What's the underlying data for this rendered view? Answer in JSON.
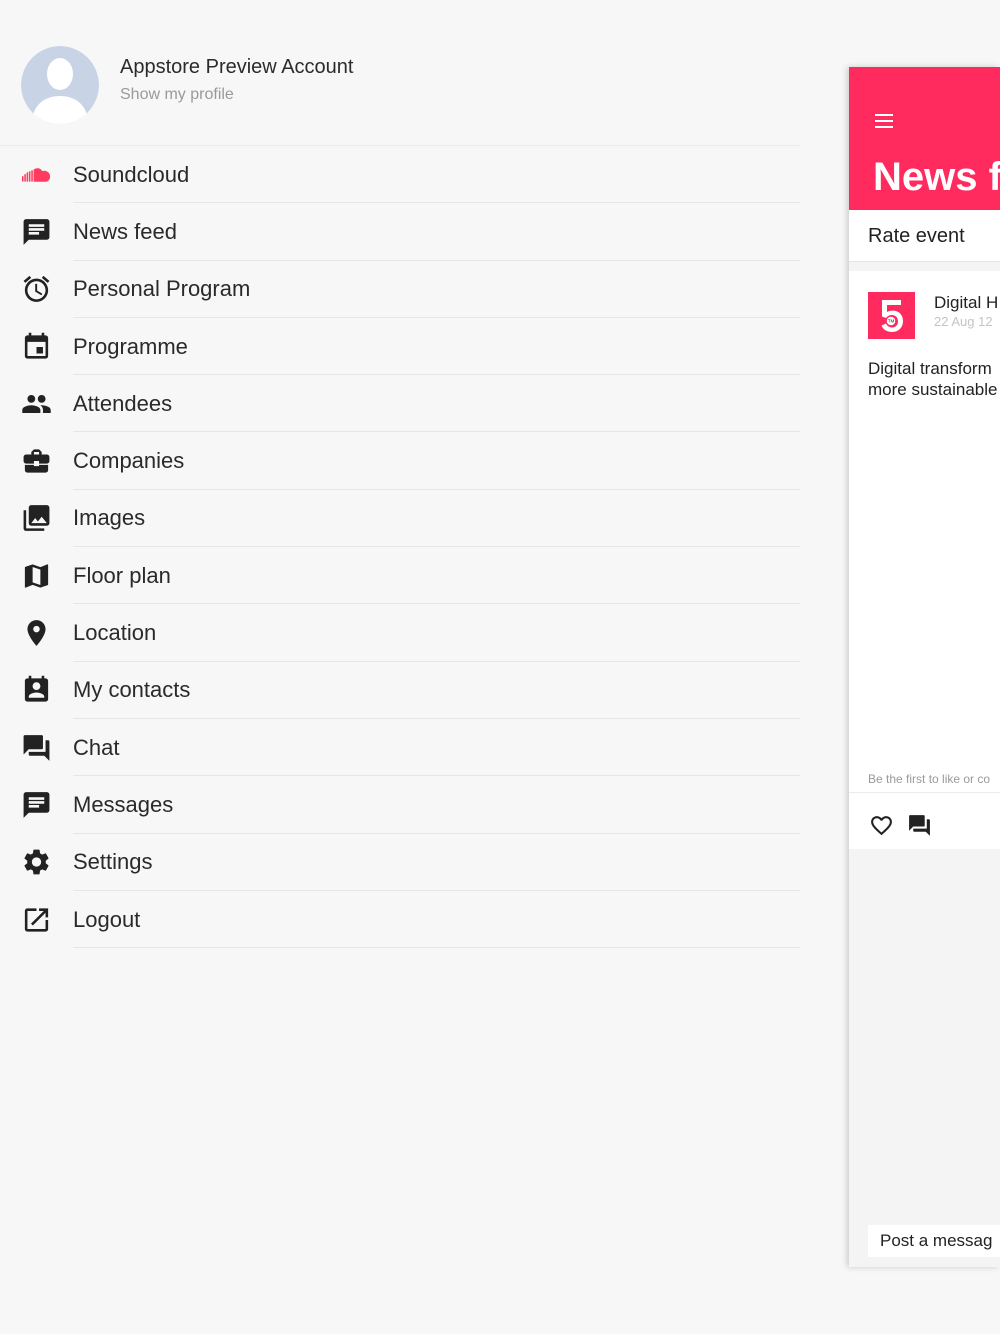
{
  "profile": {
    "name": "Appstore Preview Account",
    "subtitle": "Show my profile"
  },
  "menu": [
    {
      "label": "Soundcloud",
      "icon": "soundcloud-icon"
    },
    {
      "label": "News feed",
      "icon": "chat-bubble-icon"
    },
    {
      "label": "Personal Program",
      "icon": "alarm-clock-icon"
    },
    {
      "label": "Programme",
      "icon": "calendar-icon"
    },
    {
      "label": "Attendees",
      "icon": "people-icon"
    },
    {
      "label": "Companies",
      "icon": "briefcase-icon"
    },
    {
      "label": "Images",
      "icon": "photo-library-icon"
    },
    {
      "label": "Floor plan",
      "icon": "map-icon"
    },
    {
      "label": "Location",
      "icon": "location-pin-icon"
    },
    {
      "label": "My contacts",
      "icon": "contact-card-icon"
    },
    {
      "label": "Chat",
      "icon": "forum-icon"
    },
    {
      "label": "Messages",
      "icon": "message-icon"
    },
    {
      "label": "Settings",
      "icon": "gear-icon"
    },
    {
      "label": "Logout",
      "icon": "external-link-icon"
    }
  ],
  "panel": {
    "title": "News fe",
    "rate_label": "Rate event",
    "post": {
      "author": "Digital H",
      "date": "22 Aug 12",
      "text_line1": "Digital transform",
      "text_line2": "more sustainable",
      "likes_text": "Be the first to like or co"
    },
    "input_placeholder": "Post a messag"
  },
  "colors": {
    "accent": "#ff2b5e",
    "background": "#f7f7f7",
    "soundcloud": "#ff3c5f"
  }
}
